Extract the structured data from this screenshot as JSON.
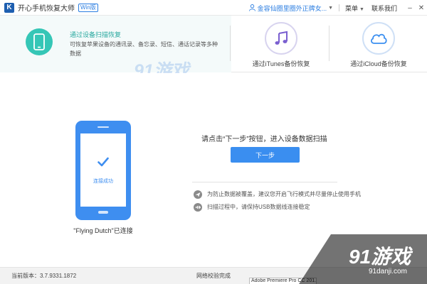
{
  "titlebar": {
    "logo_letter": "K",
    "app_title": "开心手机恢复大师",
    "badge": "Win版",
    "user_name": "金容仙圈里圈外正牌女...",
    "menu_label": "菜单",
    "contact_label": "联系我们",
    "buttons": {
      "minimize": "–",
      "close": "✕"
    }
  },
  "modes": {
    "device": {
      "title": "通过设备扫描恢复",
      "description": "可恢复苹果设备的通讯录、备忘录、短信、通话记录等多种数据",
      "icon": "phone-icon",
      "accent": "#35c6b6"
    },
    "itunes": {
      "label": "通过iTunes备份恢复",
      "icon": "music-note-icon",
      "color": "#7a5fd0"
    },
    "icloud": {
      "label": "通过iCloud备份恢复",
      "icon": "cloud-icon",
      "color": "#3a8ef0"
    }
  },
  "main": {
    "screen_text": "连接成功",
    "device_connected": "\"Flying Dutch\"已连接",
    "prompt": "请点击“下一步”按钮，进入设备数据扫描",
    "next_button": "下一步",
    "tips": [
      {
        "icon": "airplane-icon",
        "text": "为防止数据被覆盖，建议您开启飞行模式并尽量停止使用手机"
      },
      {
        "icon": "usb-icon",
        "text": "扫描过程中，请保持USB数据线连接稳定"
      }
    ],
    "accent": "#3e8ef0"
  },
  "status": {
    "version": "当前版本：3.7.9331.1872",
    "network": "网络校验完成",
    "taskbar_item": "Adobe Premiere Pro CC 201..."
  },
  "watermark": {
    "big": "91游戏",
    "small": "91danji.com"
  }
}
